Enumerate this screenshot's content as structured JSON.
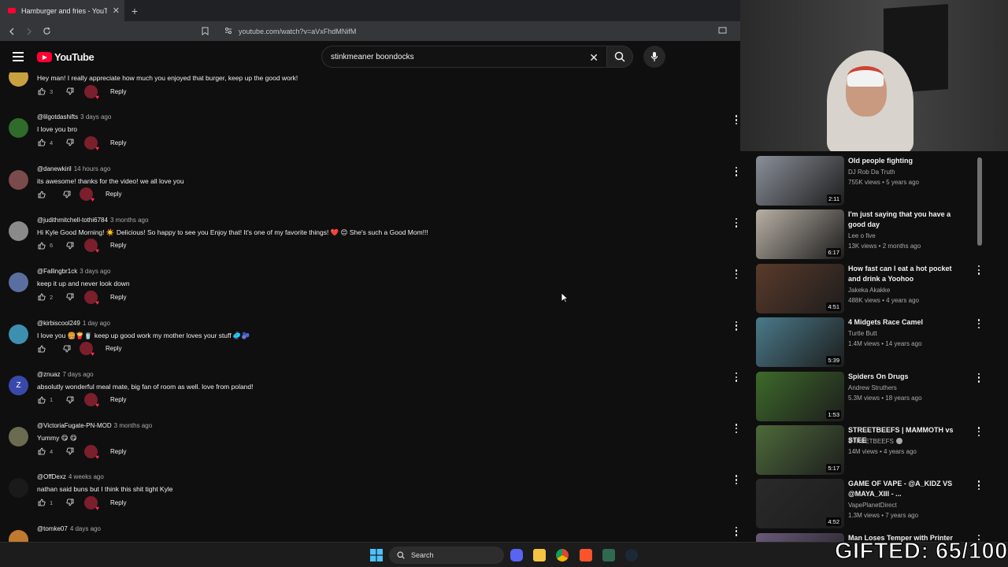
{
  "browser": {
    "tab_title": "Hamburger and fries - YouTube",
    "new_tab": "+",
    "url": "youtube.com/watch?v=aVxFhdMNifM"
  },
  "masthead": {
    "logo_text": "YouTube",
    "search_query": "stinkmeaner boondocks"
  },
  "comments": [
    {
      "handle": "",
      "age": "",
      "text": "Hey man! I really appreciate how much you enjoyed that burger, keep up the good work!",
      "likes": "3",
      "reply": "Reply",
      "avatar_color": "#c9a040"
    },
    {
      "handle": "@lilgotdashifts",
      "age": "3 days ago",
      "text": "I love you bro",
      "likes": "4",
      "reply": "Reply",
      "avatar_color": "#2f6b2a"
    },
    {
      "handle": "@danewkiril",
      "age": "14 hours ago",
      "text": "its awesome! thanks for the video! we all love you",
      "likes": "",
      "reply": "Reply",
      "avatar_color": "#7a4b4b"
    },
    {
      "handle": "@judithmitchell-tothi6784",
      "age": "3 months ago",
      "text": "Hi Kyle Good Morning! ☀️ Delicious!   So happy to see you Enjoy that! It's one of my favorite things! ❤️ 😊 She's such a Good Mom!!!",
      "likes": "6",
      "reply": "Reply",
      "avatar_color": "#8a8a8a"
    },
    {
      "handle": "@Fallingbr1ck",
      "age": "3 days ago",
      "text": "keep it up and never look down",
      "likes": "2",
      "reply": "Reply",
      "avatar_color": "#5a6fa0"
    },
    {
      "handle": "@kirbiscool249",
      "age": "1 day ago",
      "text": "I love you 🍔🍟🥤 keep up good work my mother loves your stuff 🥏🫐",
      "likes": "",
      "reply": "Reply",
      "avatar_color": "#3d8fb0"
    },
    {
      "handle": "@znuaz",
      "age": "7 days ago",
      "text": "absolutly wonderful meal mate, big fan of room as well. love from poland!",
      "likes": "1",
      "reply": "Reply",
      "avatar_color": "#3949ab",
      "avatar_letter": "Z"
    },
    {
      "handle": "@VictoriaFugate-PN-MOD",
      "age": "3 months ago",
      "text": "Yummy 😋 😋",
      "likes": "4",
      "reply": "Reply",
      "avatar_color": "#6b6b50"
    },
    {
      "handle": "@OffDexz",
      "age": "4 weeks ago",
      "text": "nathan said buns but I think this shit tight Kyle",
      "likes": "1",
      "reply": "Reply",
      "avatar_color": "#1a1a1a"
    },
    {
      "handle": "@tomke07",
      "age": "4 days ago",
      "text": "",
      "likes": "",
      "reply": "",
      "avatar_color": "#c07a30"
    }
  ],
  "recommendations": [
    {
      "title": "Old people fighting",
      "channel": "DJ Rob Da Truth",
      "meta": "755K views • 5 years ago",
      "duration": "2:11",
      "thumb_color": "#8a8f99"
    },
    {
      "title": "I'm just saying that you have a good day",
      "channel": "Lee o five",
      "meta": "13K views • 2 months ago",
      "duration": "6:17",
      "thumb_color": "#b8b0a5"
    },
    {
      "title": "How fast can I eat a hot pocket and drink a Yoohoo",
      "channel": "Jakeka Akakke",
      "meta": "488K views • 4 years ago",
      "duration": "4:51",
      "thumb_color": "#5a3a2a"
    },
    {
      "title": "4 Midgets Race Camel",
      "channel": "Turtle Butt",
      "meta": "1.4M views • 14 years ago",
      "duration": "5:39",
      "thumb_color": "#4a7a8a"
    },
    {
      "title": "Spiders On Drugs",
      "channel": "Andrew Struthers",
      "meta": "5.3M views • 18 years ago",
      "duration": "1:53",
      "thumb_color": "#3d6a2a"
    },
    {
      "title": "STREETBEEFS | MAMMOTH vs STEE",
      "channel": "STREETBEEFS",
      "meta": "14M views • 4 years ago",
      "duration": "5:17",
      "thumb_color": "#4d6a3a",
      "verified": true
    },
    {
      "title": "GAME OF VAPE - @A_KIDZ VS @MAYA_XIII - ...",
      "channel": "VapePlanetDirect",
      "meta": "1.3M views • 7 years ago",
      "duration": "4:52",
      "thumb_color": "#2a2a2a"
    },
    {
      "title": "Man Loses Temper with Printer",
      "channel": "",
      "meta": "",
      "duration": "",
      "thumb_color": "#6a5a7a"
    }
  ],
  "taskbar": {
    "search_label": "Search"
  },
  "overlay": {
    "gifted_text": "GIFTED: 65/100"
  }
}
